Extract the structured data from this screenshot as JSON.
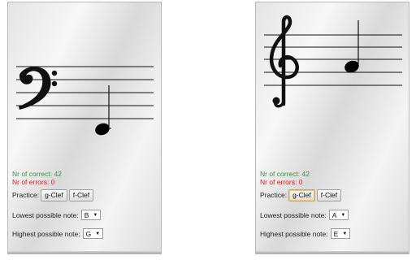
{
  "left": {
    "clef": "f-clef",
    "correct_label": "Nr of correct: 42",
    "errors_label": "Nr of errors: 0",
    "practice_label": "Practice:",
    "practice_buttons": [
      "g-Clef",
      "f-Clef"
    ],
    "lowest_label": "Lowest possible note:",
    "lowest_value": "B",
    "highest_label": "Highest possible note:",
    "highest_value": "G"
  },
  "right": {
    "clef": "g-clef",
    "correct_label": "Nr of correct: 42",
    "errors_label": "Nr of errors: 0",
    "practice_label": "Practice:",
    "practice_buttons": [
      "g-Clef",
      "f-Clef"
    ],
    "lowest_label": "Lowest possible note:",
    "lowest_value": "A",
    "highest_label": "Highest possible note:",
    "highest_value": "E"
  },
  "colors": {
    "correct": "#3e8e3e",
    "errors": "#e01616",
    "active_border": "#e0a040"
  },
  "icons": [
    "f-clef-icon",
    "g-clef-icon",
    "dropdown-arrow-icon"
  ]
}
